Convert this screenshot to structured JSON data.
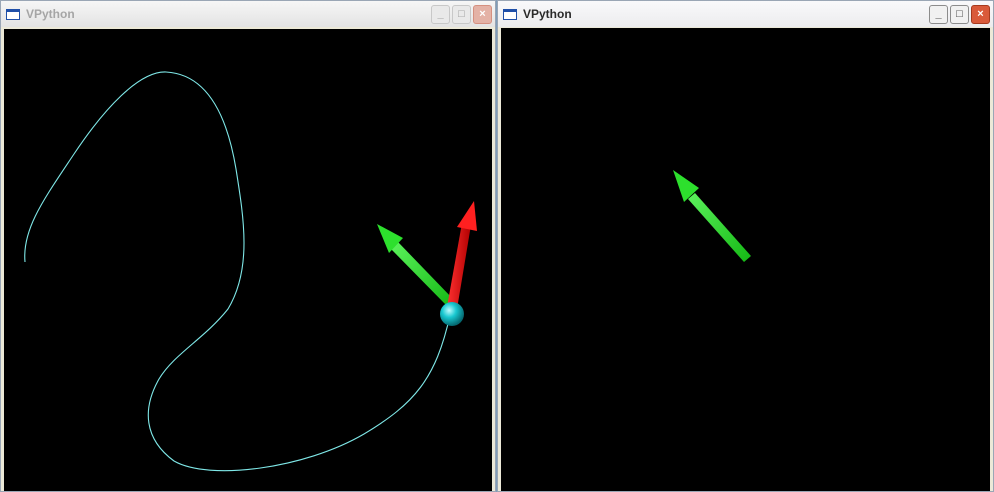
{
  "windows": [
    {
      "title": "VPython",
      "state": "inactive",
      "controls": {
        "minimize": "_",
        "maximize": "□",
        "close": "×"
      },
      "scene": {
        "background_color": "#000000",
        "trail_color": "#7fe8e8",
        "ball_color": "#10c8d0",
        "arrows": [
          {
            "name": "green-arrow",
            "color": "#20e020"
          },
          {
            "name": "red-arrow",
            "color": "#e01010"
          }
        ]
      }
    },
    {
      "title": "VPython",
      "state": "active",
      "controls": {
        "minimize": "_",
        "maximize": "□",
        "close": "×"
      },
      "scene": {
        "background_color": "#000000",
        "arrows": [
          {
            "name": "green-arrow",
            "color": "#20e020"
          }
        ]
      }
    }
  ]
}
